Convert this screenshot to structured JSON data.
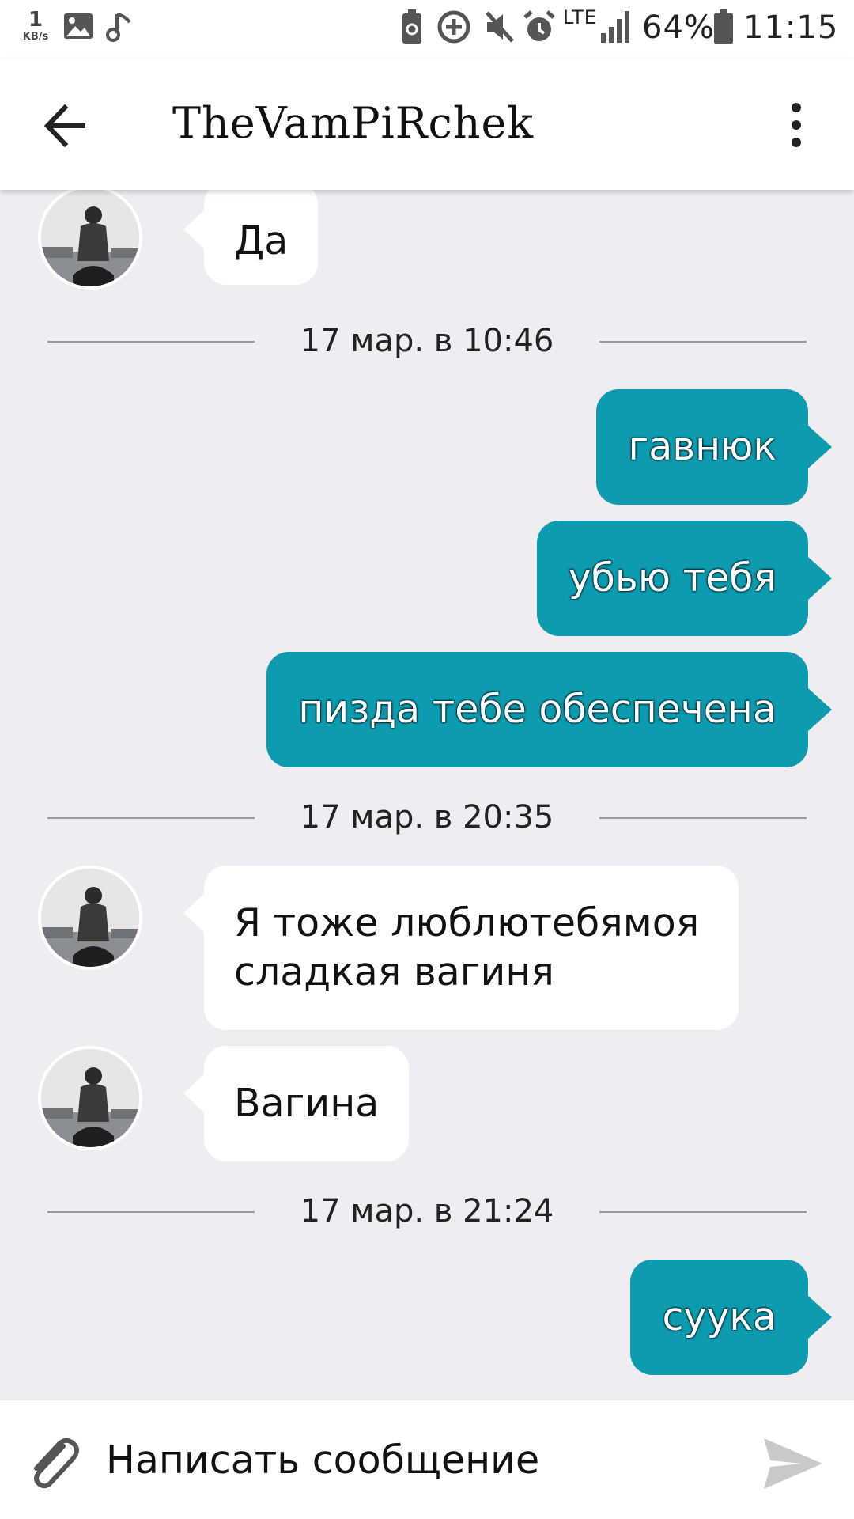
{
  "status_bar": {
    "net_speed_value": "1",
    "net_speed_unit": "KB/s",
    "network_type": "LTE",
    "battery_percent": "64%",
    "time": "11:15",
    "icons": [
      "image-icon",
      "music-note-icon",
      "battery-saver-icon",
      "data-saver-icon",
      "mute-icon",
      "alarm-icon",
      "signal-icon",
      "battery-icon"
    ]
  },
  "header": {
    "title": "TheVamPiRchek",
    "back_icon": "arrow-left-icon",
    "menu_icon": "more-vert-icon"
  },
  "messages": [
    {
      "type": "incoming",
      "text": "Да"
    },
    {
      "type": "date",
      "text": "17 мар. в 10:46"
    },
    {
      "type": "outgoing",
      "text": "гавнюк"
    },
    {
      "type": "outgoing",
      "text": "убью тебя"
    },
    {
      "type": "outgoing",
      "text": "пизда тебе обеспечена"
    },
    {
      "type": "date",
      "text": "17 мар. в 20:35"
    },
    {
      "type": "incoming",
      "lines": [
        "Я тоже люблютебямоя",
        "сладкая вагиня"
      ]
    },
    {
      "type": "incoming",
      "text": "Вагина"
    },
    {
      "type": "date",
      "text": "17 мар. в 21:24"
    },
    {
      "type": "outgoing",
      "text": "суука"
    }
  ],
  "composer": {
    "placeholder": "Написать сообщение",
    "attach_icon": "paperclip-icon",
    "send_icon": "send-icon"
  },
  "colors": {
    "outgoing_bubble": "#0d9bb0",
    "incoming_bubble": "#ffffff",
    "chat_background": "#efedf1"
  }
}
